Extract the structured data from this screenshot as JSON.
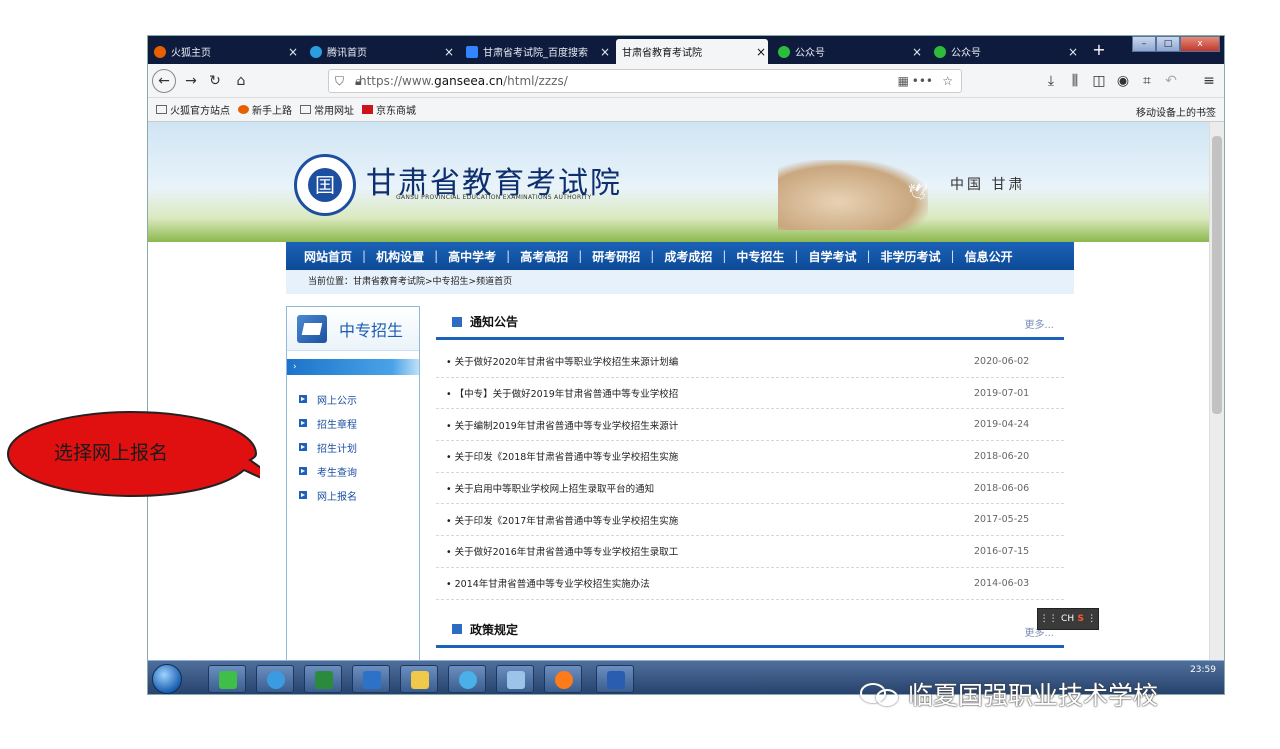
{
  "browser": {
    "tabs": [
      {
        "label": "火狐主页",
        "active": false,
        "icon": "firefox-icon",
        "color": "#e66000"
      },
      {
        "label": "腾讯首页",
        "active": false,
        "icon": "tencent-icon",
        "color": "#2a9fe0"
      },
      {
        "label": "甘肃省考试院_百度搜索",
        "active": false,
        "icon": "baidu-icon",
        "color": "#3385ff"
      },
      {
        "label": "甘肃省教育考试院",
        "active": true,
        "icon": "",
        "color": ""
      },
      {
        "label": "公众号",
        "active": false,
        "icon": "wechat-icon",
        "color": "#2dbb3c"
      },
      {
        "label": "公众号",
        "active": false,
        "icon": "wechat-icon",
        "color": "#2dbb3c"
      }
    ],
    "url_prefix": "https://www.",
    "url_domain": "ganseea.cn",
    "url_path": "/html/zzzs/",
    "bookmarks": [
      "火狐官方站点",
      "新手上路",
      "常用网址",
      "京东商城"
    ],
    "bookmarks_right": "移动设备上的书签"
  },
  "site": {
    "title": "甘肃省教育考试院",
    "subtitle": "GANSU PROVINCIAL EDUCATION EXAMINATIONS AUTHORITY",
    "logo_char": "囯",
    "location": "中国 甘肃",
    "nav": [
      "网站首页",
      "机构设置",
      "高中学考",
      "高考高招",
      "研考研招",
      "成考成招",
      "中专招生",
      "自学考试",
      "非学历考试",
      "信息公开"
    ],
    "breadcrumb": "当前位置：甘肃省教育考试院>中专招生>频道首页"
  },
  "sidebar": {
    "title": "中专招生",
    "strip": "›",
    "items": [
      "网上公示",
      "招生章程",
      "招生计划",
      "考生查询",
      "网上报名"
    ]
  },
  "news": {
    "title": "通知公告",
    "more": "更多...",
    "items": [
      {
        "title": "• 关于做好2020年甘肃省中等职业学校招生来源计划编",
        "date": "2020-06-02"
      },
      {
        "title": "• 【中专】关于做好2019年甘肃省普通中等专业学校招",
        "date": "2019-07-01"
      },
      {
        "title": "• 关于编制2019年甘肃省普通中等专业学校招生来源计",
        "date": "2019-04-24"
      },
      {
        "title": "• 关于印发《2018年甘肃省普通中等专业学校招生实施",
        "date": "2018-06-20"
      },
      {
        "title": "• 关于启用中等职业学校网上招生录取平台的通知",
        "date": "2018-06-06"
      },
      {
        "title": "• 关于印发《2017年甘肃省普通中等专业学校招生实施",
        "date": "2017-05-25"
      },
      {
        "title": "• 关于做好2016年甘肃省普通中等专业学校招生录取工",
        "date": "2016-07-15"
      },
      {
        "title": "• 2014年甘肃省普通中等专业学校招生实施办法",
        "date": "2014-06-03"
      }
    ],
    "policy_title": "政策规定",
    "policy_more": "更多..."
  },
  "ime": {
    "lang": "CH",
    "logo": "S"
  },
  "taskbar": {
    "time": "23:59"
  },
  "annotation": {
    "text": "选择网上报名",
    "color": "#e01010"
  },
  "watermark": {
    "text": "临夏国强职业技术学校"
  }
}
